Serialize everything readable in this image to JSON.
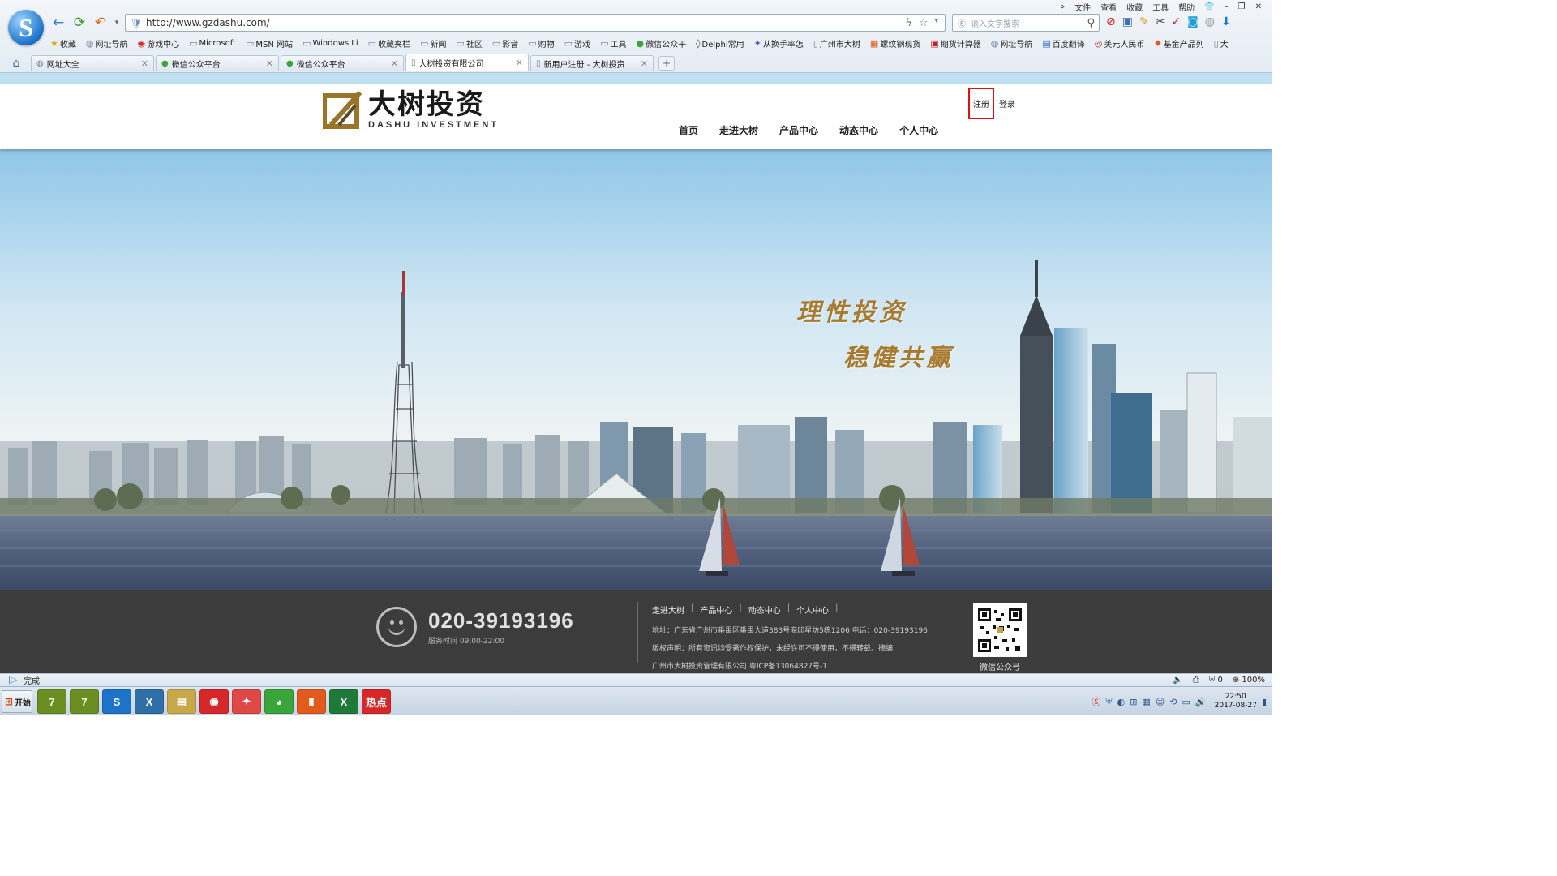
{
  "browser": {
    "menubar": [
      "»",
      "文件",
      "查看",
      "收藏",
      "工具",
      "帮助"
    ],
    "url": "http://www.gzdashu.com/",
    "search_placeholder": "输入文字搜索",
    "bookmarks": [
      {
        "label": "收藏",
        "icon": "star-icon"
      },
      {
        "label": "网址导航",
        "icon": "globe-icon"
      },
      {
        "label": "游戏中心",
        "icon": "game-icon"
      },
      {
        "label": "Microsoft",
        "icon": "folder-icon"
      },
      {
        "label": "MSN 网站",
        "icon": "folder-icon"
      },
      {
        "label": "Windows Li",
        "icon": "folder-icon"
      },
      {
        "label": "收藏夹栏",
        "icon": "folder-icon"
      },
      {
        "label": "新闻",
        "icon": "folder-icon"
      },
      {
        "label": "社区",
        "icon": "folder-icon"
      },
      {
        "label": "影音",
        "icon": "folder-icon"
      },
      {
        "label": "购物",
        "icon": "folder-icon"
      },
      {
        "label": "游戏",
        "icon": "folder-icon"
      },
      {
        "label": "工具",
        "icon": "folder-icon"
      },
      {
        "label": "微信公众平",
        "icon": "wechat-icon"
      },
      {
        "label": "Delphi常用",
        "icon": "delphi-icon"
      },
      {
        "label": "从换手率怎",
        "icon": "paw-icon"
      },
      {
        "label": "广州市大树",
        "icon": "page-icon"
      },
      {
        "label": "螺纹钢现货",
        "icon": "chart-icon"
      },
      {
        "label": "期货计算器",
        "icon": "calc-icon"
      },
      {
        "label": "网址导航",
        "icon": "globe-icon"
      },
      {
        "label": "百度翻译",
        "icon": "translate-icon"
      },
      {
        "label": "美元人民币",
        "icon": "weibo-icon"
      },
      {
        "label": "基金产品列",
        "icon": "fund-icon"
      },
      {
        "label": "大",
        "icon": "page-icon"
      }
    ],
    "tabs": [
      {
        "label": "网址大全",
        "icon": "globe-icon",
        "active": false
      },
      {
        "label": "微信公众平台",
        "icon": "wechat-icon",
        "active": false
      },
      {
        "label": "微信公众平台",
        "icon": "wechat-icon",
        "active": false
      },
      {
        "label": "大树投资有限公司",
        "icon": "page-icon",
        "active": true
      },
      {
        "label": "新用户注册 - 大树投资",
        "icon": "page-icon",
        "active": false
      }
    ],
    "status_text": "完成",
    "zoom": "100%",
    "counter": "0"
  },
  "site": {
    "brand_cn": "大树投资",
    "brand_en": "DASHU INVESTMENT",
    "register": "注册",
    "login": "登录",
    "nav": [
      "首页",
      "走进大树",
      "产品中心",
      "动态中心",
      "个人中心"
    ],
    "slogan_line1": "理性投资",
    "slogan_line2": "稳健共赢",
    "footer": {
      "phone": "020-39193196",
      "service_hours": "服务时间 09:00-22:00",
      "links": [
        "走进大树",
        "产品中心",
        "动态中心",
        "个人中心"
      ],
      "address": "地址：广东省广州市番禺区番禺大道383号海印星坊5栋1206 电话：020-39193196",
      "copyright": "版权声明：所有资讯均受著作权保护，未经许可不得使用，不得转载、摘编",
      "icp": "广州市大树投资管理有限公司 粤ICP备13064827号-1",
      "qr_label": "微信公众号"
    }
  },
  "taskbar": {
    "start_label": "开始",
    "apps": [
      {
        "label": "7",
        "color": "#6b8e23"
      },
      {
        "label": "7",
        "color": "#6b8e23"
      },
      {
        "label": "S",
        "color": "#1d72c9"
      },
      {
        "label": "X",
        "color": "#2f6fa8"
      },
      {
        "label": "▤",
        "color": "#c9a84a"
      },
      {
        "label": "◉",
        "color": "#d62828"
      },
      {
        "label": "✦",
        "color": "#e04848"
      },
      {
        "label": "◕",
        "color": "#3aa63a"
      },
      {
        "label": "▮",
        "color": "#e25a1c"
      },
      {
        "label": "X",
        "color": "#1f7a3a"
      },
      {
        "label": "热点",
        "color": "#d62828"
      }
    ],
    "time": "22:50",
    "date": "2017-08-27"
  }
}
